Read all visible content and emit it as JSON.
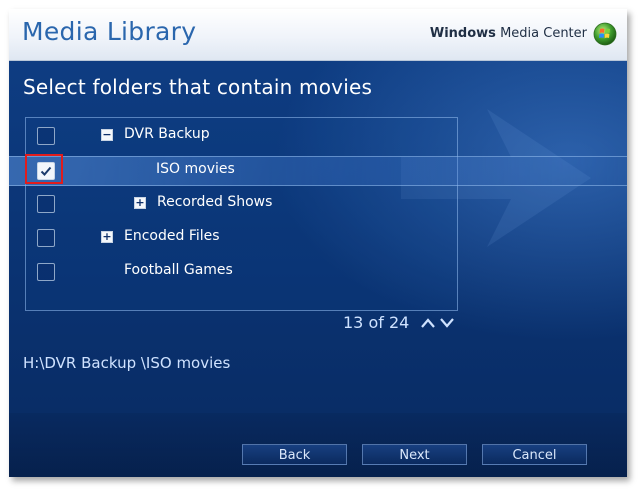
{
  "header": {
    "title": "Media Library",
    "brand_windows": "Windows",
    "brand_product": "Media Center",
    "logo_icon": "windows-flag-icon"
  },
  "main": {
    "heading": "Select folders that contain movies",
    "folders": [
      {
        "label": "DVR Backup",
        "checked": false,
        "expander": "−",
        "selected": false
      },
      {
        "label": "ISO movies",
        "checked": true,
        "expander": "",
        "selected": true
      },
      {
        "label": "Recorded Shows",
        "checked": false,
        "expander": "+",
        "selected": false
      },
      {
        "label": "Encoded Files",
        "checked": false,
        "expander": "+",
        "selected": false
      },
      {
        "label": "Football Games",
        "checked": false,
        "expander": "",
        "selected": false
      }
    ],
    "pager": "13 of 24",
    "path": "H:\\DVR Backup \\ISO movies"
  },
  "footer": {
    "back_label": "Back",
    "next_label": "Next",
    "cancel_label": "Cancel"
  },
  "colors": {
    "accent": "#2a66ad",
    "background": "#0b3576",
    "highlight_box": "#e11c1c"
  }
}
